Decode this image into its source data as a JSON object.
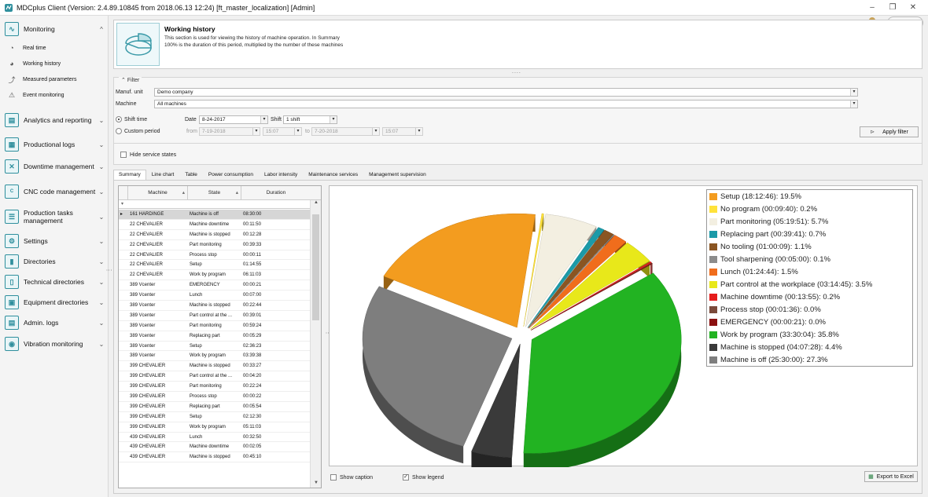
{
  "window": {
    "title": "MDCplus Client (Version: 2.4.89.10845 from 2018.06.13 12:24) [ft_master_localization]  [Admin]",
    "minimize": "–",
    "restore": "❐",
    "close": "✕"
  },
  "sidebar": {
    "monitoring": "Monitoring",
    "sub": [
      "Real time",
      "Working history",
      "Measured parameters",
      "Event monitoring"
    ],
    "items": [
      "Analytics and reporting",
      "Productional logs",
      "Downtime management",
      "CNC code management",
      "Production tasks management",
      "Settings",
      "Directories",
      "Technical directories",
      "Equipment directories",
      "Admin. logs",
      "Vibration monitoring"
    ]
  },
  "header": {
    "title": "Working history",
    "desc1": "This section is used for viewing the history of machine operation. In Summary",
    "desc2": "100% is the duration of this period, multiplied by the number of these machines"
  },
  "filter": {
    "legend": "Filter",
    "unit_label": "Manuf. unit",
    "unit_value": "Demo company",
    "machine_label": "Machine",
    "machine_value": "All machines",
    "shift_time": "Shift time",
    "custom_period": "Custom period",
    "date_label": "Date",
    "date_value": "8-24-2017",
    "shift_label": "Shift",
    "shift_value": "1 shift",
    "from_label": "from",
    "from_date": "7-19-2018",
    "from_time": "15:07",
    "to_label": "to",
    "to_date": "7-20-2018",
    "to_time": "15:07",
    "apply": "Apply filter",
    "hide_service": "Hide service states"
  },
  "tabs": [
    "Summary",
    "Line chart",
    "Table",
    "Power consumption",
    "Labor intensity",
    "Maintenance services",
    "Management supervision"
  ],
  "grid": {
    "columns": [
      "Machine",
      "State",
      "Duration"
    ],
    "rows": [
      [
        "161 HARDINGE",
        "Machine is off",
        "08:30:00"
      ],
      [
        "22 CHEVALIER",
        "Machine downtime",
        "00:11:50"
      ],
      [
        "22 CHEVALIER",
        "Machine is stopped",
        "00:12:28"
      ],
      [
        "22 CHEVALIER",
        "Part monitoring",
        "00:39:33"
      ],
      [
        "22 CHEVALIER",
        "Process stop",
        "00:00:11"
      ],
      [
        "22 CHEVALIER",
        "Setup",
        "01:14:55"
      ],
      [
        "22 CHEVALIER",
        "Work by program",
        "06:11:03"
      ],
      [
        "389 Vcenter",
        "EMERGENCY",
        "00:00:21"
      ],
      [
        "389 Vcenter",
        "Lunch",
        "00:07:00"
      ],
      [
        "389 Vcenter",
        "Machine is stopped",
        "00:22:44"
      ],
      [
        "389 Vcenter",
        "Part control at the ...",
        "00:39:01"
      ],
      [
        "389 Vcenter",
        "Part monitoring",
        "00:59:24"
      ],
      [
        "389 Vcenter",
        "Replacing part",
        "00:05:29"
      ],
      [
        "389 Vcenter",
        "Setup",
        "02:36:23"
      ],
      [
        "389 Vcenter",
        "Work by program",
        "03:39:38"
      ],
      [
        "399 CHEVALIER",
        "Machine is stopped",
        "00:33:27"
      ],
      [
        "399 CHEVALIER",
        "Part control at the ...",
        "00:04:20"
      ],
      [
        "399 CHEVALIER",
        "Part monitoring",
        "00:22:24"
      ],
      [
        "399 CHEVALIER",
        "Process stop",
        "00:00:22"
      ],
      [
        "399 CHEVALIER",
        "Replacing part",
        "00:05:54"
      ],
      [
        "399 CHEVALIER",
        "Setup",
        "02:12:30"
      ],
      [
        "399 CHEVALIER",
        "Work by program",
        "05:11:03"
      ],
      [
        "439 CHEVALIER",
        "Lunch",
        "00:32:50"
      ],
      [
        "439 CHEVALIER",
        "Machine downtime",
        "00:02:05"
      ],
      [
        "439 CHEVALIER",
        "Machine is stopped",
        "00:45:10"
      ]
    ]
  },
  "chart_data": {
    "type": "pie",
    "slices": [
      {
        "label": "Setup (18:12:46): 19.5%",
        "value": 19.5,
        "color": "#f39c1f"
      },
      {
        "label": "No program (00:09:40): 0.2%",
        "value": 0.2,
        "color": "#ffe23a"
      },
      {
        "label": "Part monitoring (05:19:51): 5.7%",
        "value": 5.7,
        "color": "#f3efe1"
      },
      {
        "label": "Replacing part (00:39:41): 0.7%",
        "value": 0.7,
        "color": "#1b9aa8"
      },
      {
        "label": "No tooling (01:00:09): 1.1%",
        "value": 1.1,
        "color": "#8a5522"
      },
      {
        "label": "Tool sharpening (00:05:00): 0.1%",
        "value": 0.1,
        "color": "#8c8c8c"
      },
      {
        "label": "Lunch (01:24:44): 1.5%",
        "value": 1.5,
        "color": "#f06d1c"
      },
      {
        "label": "Part control at the workplace (03:14:45): 3.5%",
        "value": 3.5,
        "color": "#e8e81a"
      },
      {
        "label": "Machine downtime (00:13:55): 0.2%",
        "value": 0.2,
        "color": "#e51c1c"
      },
      {
        "label": "Process stop (00:01:36): 0.0%",
        "value": 0.0,
        "color": "#7b4a3b"
      },
      {
        "label": "EMERGENCY (00:00:21): 0.0%",
        "value": 0.0,
        "color": "#8b1010"
      },
      {
        "label": "Work by program (33:30:04): 35.8%",
        "value": 35.8,
        "color": "#22b322"
      },
      {
        "label": "Machine is stopped (04:07:28): 4.4%",
        "value": 4.4,
        "color": "#3a3a3a"
      },
      {
        "label": "Machine is off (25:30:00): 27.3%",
        "value": 27.3,
        "color": "#7e7e7e"
      }
    ]
  },
  "bottom": {
    "show_caption": "Show caption",
    "show_legend": "Show legend",
    "export": "Export to Excel"
  }
}
